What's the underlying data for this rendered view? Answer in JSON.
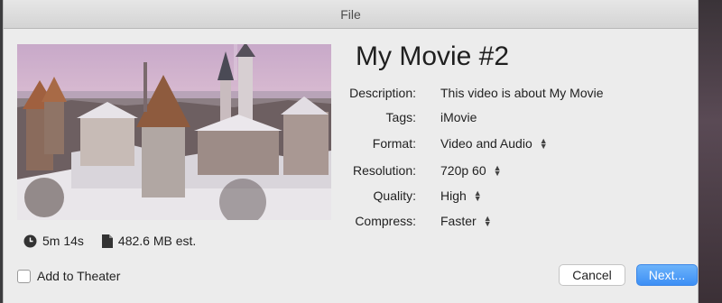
{
  "window": {
    "title": "File"
  },
  "movie": {
    "title": "My Movie #2"
  },
  "stats": {
    "duration": "5m 14s",
    "size": "482.6 MB est."
  },
  "fields": {
    "description": {
      "label": "Description:",
      "value": "This video is about My Movie"
    },
    "tags": {
      "label": "Tags:",
      "value": "iMovie"
    },
    "format": {
      "label": "Format:",
      "value": "Video and Audio"
    },
    "resolution": {
      "label": "Resolution:",
      "value": "720p 60"
    },
    "quality": {
      "label": "Quality:",
      "value": "High"
    },
    "compress": {
      "label": "Compress:",
      "value": "Faster"
    }
  },
  "checkbox": {
    "label": "Add to Theater",
    "checked": false
  },
  "buttons": {
    "cancel": "Cancel",
    "next": "Next..."
  },
  "icons": {
    "duration": "clock-icon",
    "size": "document-icon",
    "stepper": "up-down-arrows-icon"
  },
  "colors": {
    "accent": "#3d8ff5",
    "background": "#ececec"
  }
}
